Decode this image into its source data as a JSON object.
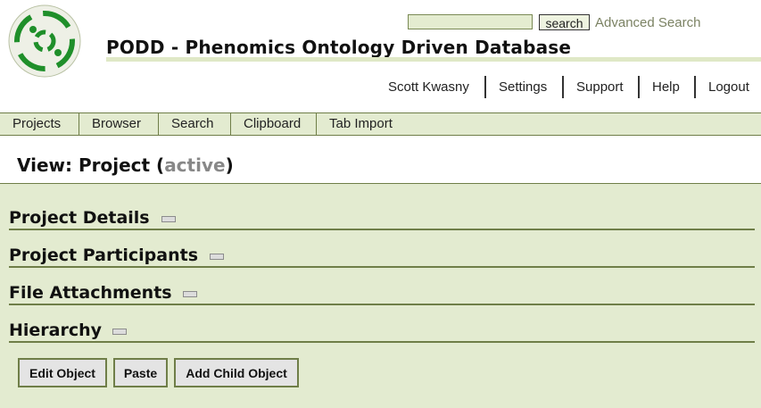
{
  "header": {
    "site_title": "PODD - Phenomics Ontology Driven Database",
    "search_value": "",
    "search_button": "search",
    "advanced_search": "Advanced Search"
  },
  "user_nav": [
    "Scott Kwasny",
    "Settings",
    "Support",
    "Help",
    "Logout"
  ],
  "tabs": [
    "Projects",
    "Browser",
    "Search",
    "Clipboard",
    "Tab Import"
  ],
  "view": {
    "prefix": "View: Project (",
    "status": "active",
    "suffix": ")"
  },
  "sections": [
    "Project Details",
    "Project Participants",
    "File Attachments",
    "Hierarchy"
  ],
  "actions": {
    "edit": "Edit Object",
    "paste": "Paste",
    "add_child": "Add Child Object"
  },
  "colors": {
    "accent_green": "#e3ebd0",
    "rule_green": "#6f7e48",
    "logo_green": "#1f8f2a"
  }
}
